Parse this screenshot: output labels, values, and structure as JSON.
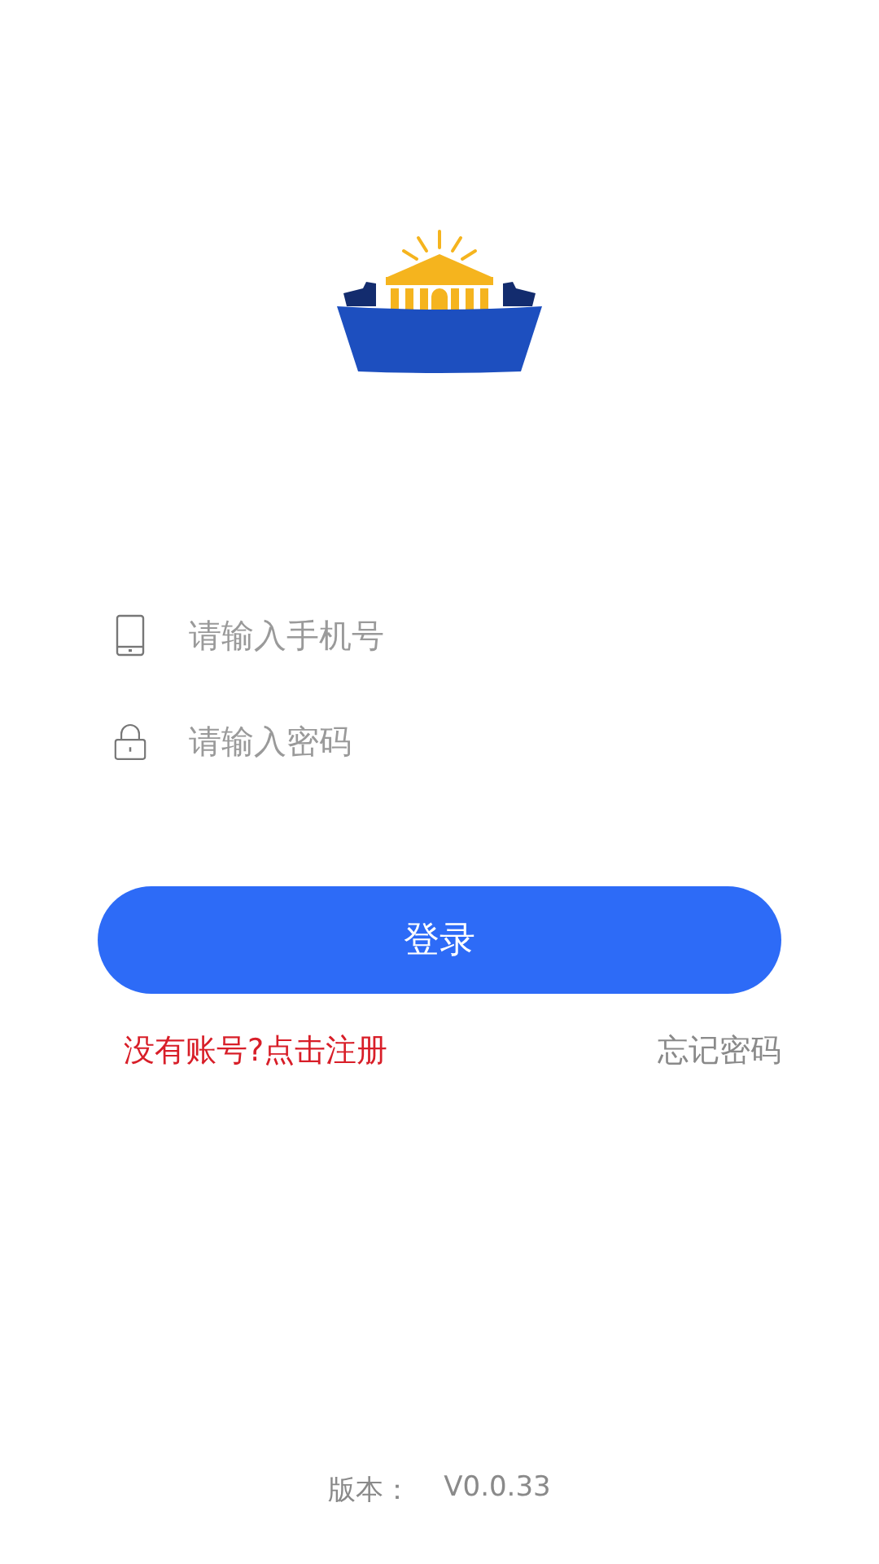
{
  "login_form": {
    "fields": [
      {
        "kind": "phone",
        "placeholder": "请输入手机号"
      },
      {
        "kind": "password",
        "placeholder": "请输入密码"
      }
    ],
    "login_button": "登录",
    "register_link": "没有账号?点击注册",
    "forgot_link": "忘记密码"
  },
  "footer": {
    "version_label": "版本：",
    "version": "V0.0.33"
  }
}
